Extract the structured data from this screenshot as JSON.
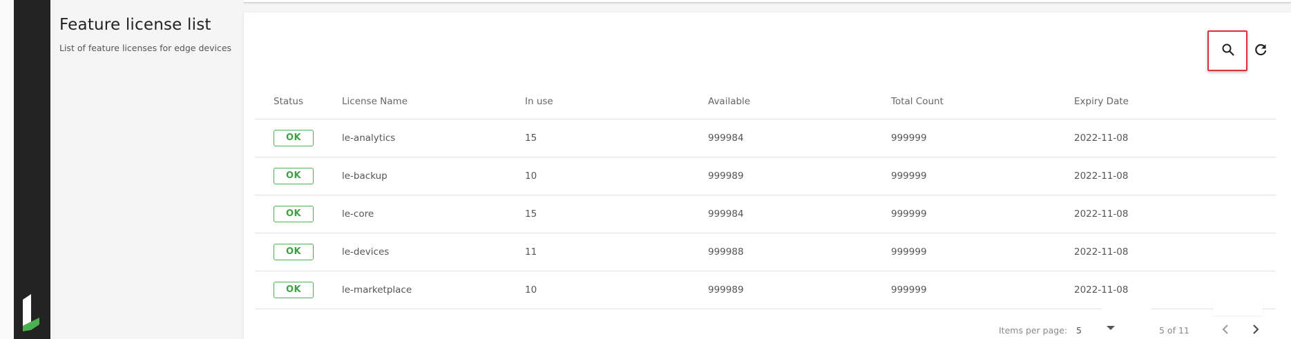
{
  "section": {
    "title": "Feature license list",
    "subtitle": "List of feature licenses for edge devices"
  },
  "toolbar": {
    "search_icon": "search-icon",
    "refresh_icon": "refresh-icon"
  },
  "table": {
    "columns": [
      "Status",
      "License Name",
      "In use",
      "Available",
      "Total Count",
      "Expiry Date"
    ],
    "rows": [
      {
        "status": "OK",
        "name": "le-analytics",
        "in_use": "15",
        "available": "999984",
        "total": "999999",
        "expiry": "2022-11-08"
      },
      {
        "status": "OK",
        "name": "le-backup",
        "in_use": "10",
        "available": "999989",
        "total": "999999",
        "expiry": "2022-11-08"
      },
      {
        "status": "OK",
        "name": "le-core",
        "in_use": "15",
        "available": "999984",
        "total": "999999",
        "expiry": "2022-11-08"
      },
      {
        "status": "OK",
        "name": "le-devices",
        "in_use": "11",
        "available": "999988",
        "total": "999999",
        "expiry": "2022-11-08"
      },
      {
        "status": "OK",
        "name": "le-marketplace",
        "in_use": "10",
        "available": "999989",
        "total": "999999",
        "expiry": "2022-11-08"
      }
    ]
  },
  "pagination": {
    "items_per_page_label": "Items per page:",
    "items_per_page_value": "5",
    "range": "5 of 11"
  },
  "colors": {
    "sidebar": "#232323",
    "logo_accent": "#4caf50",
    "ok_green": "#3f9f44",
    "highlight_red": "#d9303a"
  }
}
